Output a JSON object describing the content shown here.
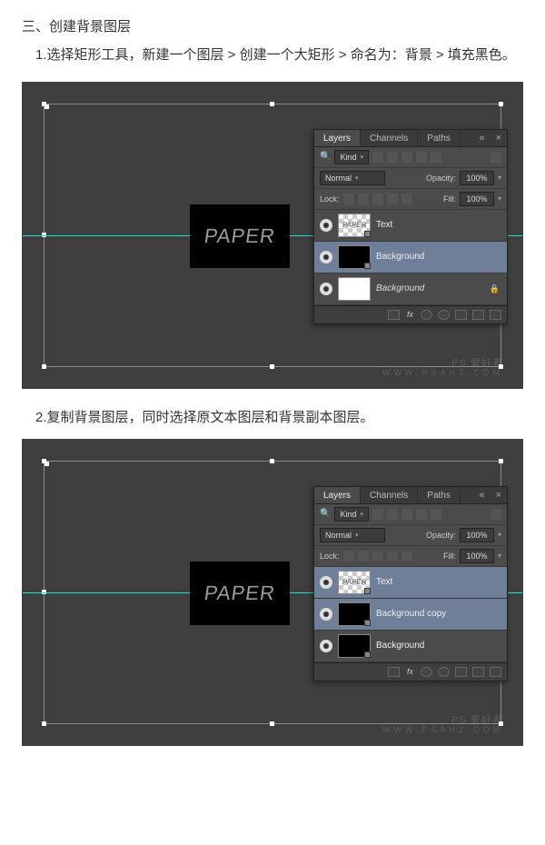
{
  "heading": "三、创建背景图层",
  "step1": "1.选择矩形工具，新建一个图层 > 创建一个大矩形 > 命名为：背景 > 填充黑色。",
  "step2": "2.复制背景图层，同时选择原文本图层和背景副本图层。",
  "paper_text": "PAPER",
  "watermark_main": "PS 爱好者",
  "watermark_sub": "WWW.PSAHZ.COM",
  "panel_common": {
    "tabs": {
      "layers": "Layers",
      "channels": "Channels",
      "paths": "Paths"
    },
    "kind_label": "Kind",
    "blend_mode": "Normal",
    "opacity_label": "Opacity:",
    "opacity_value": "100%",
    "lock_label": "Lock:",
    "fill_label": "Fill:",
    "fill_value": "100%",
    "fx_label": "fx"
  },
  "panel1": {
    "layers": [
      {
        "name": "Text",
        "thumb": "paper",
        "selected": false,
        "italic": false
      },
      {
        "name": "Background",
        "thumb": "black",
        "selected": true,
        "italic": false
      },
      {
        "name": "Background",
        "thumb": "white",
        "selected": false,
        "italic": true,
        "locked": true
      }
    ]
  },
  "panel2": {
    "layers": [
      {
        "name": "Text",
        "thumb": "paper",
        "selected": true,
        "italic": false
      },
      {
        "name": "Background copy",
        "thumb": "black",
        "selected": true,
        "italic": false
      },
      {
        "name": "Background",
        "thumb": "black",
        "selected": false,
        "italic": false
      }
    ]
  }
}
